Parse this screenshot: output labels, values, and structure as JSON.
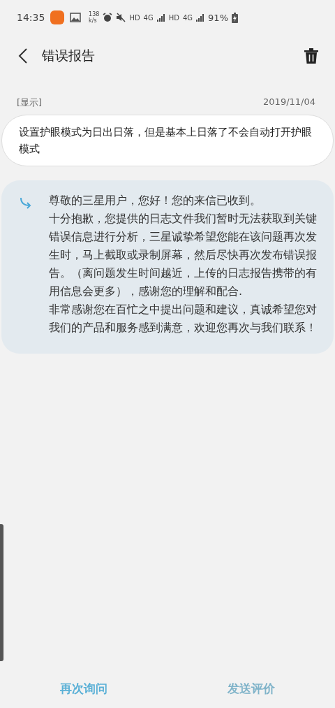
{
  "status_bar": {
    "time": "14:35",
    "speed_value": "138",
    "speed_unit": "k/s",
    "network_labels": [
      "HD",
      "4G",
      "HD",
      "4G"
    ],
    "battery": "91%"
  },
  "header": {
    "title": "错误报告"
  },
  "report": {
    "tag": "[显示]",
    "date": "2019/11/04",
    "text": "设置护眼模式为日出日落，但是基本上日落了不会自动打开护眼模式"
  },
  "reply": {
    "paragraphs": [
      "尊敬的三星用户，您好！您的来信已收到。",
      "十分抱歉，您提供的日志文件我们暂时无法获取到关键错误信息进行分析，三星诚挚希望您能在该问题再次发生时，马上截取或录制屏幕，然后尽快再次发布错误报告。（离问题发生时间越近，上传的日志报告携带的有用信息会更多），感谢您的理解和配合.",
      "非常感谢您在百忙之中提出问题和建议，真诚希望您对我们的产品和服务感到满意，欢迎您再次与我们联系！"
    ]
  },
  "actions": [
    {
      "label": "再次询问",
      "disabled": false
    },
    {
      "label": "发送评价",
      "disabled": true
    }
  ]
}
